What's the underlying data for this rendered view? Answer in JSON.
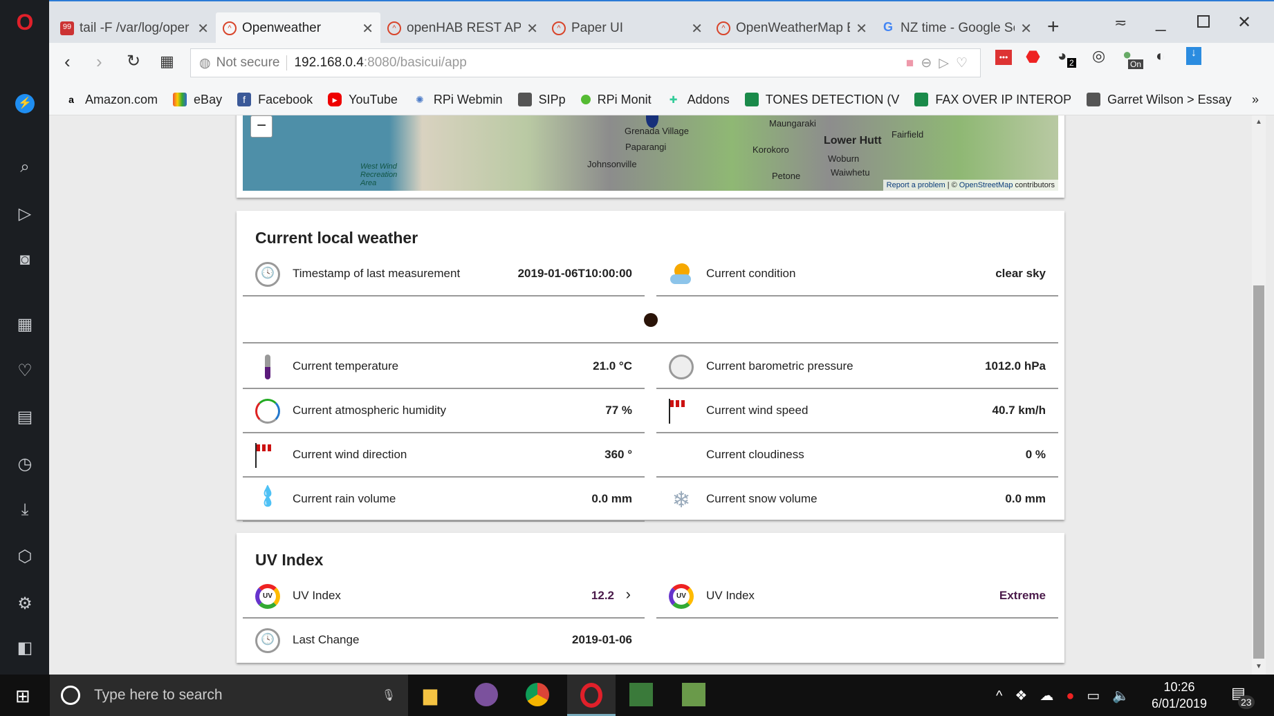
{
  "browser": {
    "tabs": [
      {
        "label": "tail -F /var/log/oper",
        "icon": "f99-icon"
      },
      {
        "label": "Openweather",
        "icon": "openhab-icon",
        "active": true
      },
      {
        "label": "openHAB REST API",
        "icon": "openhab-icon"
      },
      {
        "label": "Paper UI",
        "icon": "openhab-icon"
      },
      {
        "label": "OpenWeatherMap E",
        "icon": "openhab-icon"
      },
      {
        "label": "NZ time - Google Se",
        "icon": "google-icon"
      }
    ],
    "security": "Not secure",
    "url_host": "192.168.0.4",
    "url_rest": ":8080/basicui/app",
    "ext_badges": {
      "count": "2",
      "toggle": "On"
    },
    "bookmarks": [
      "Amazon.com",
      "eBay",
      "Facebook",
      "YouTube",
      "RPi Webmin",
      "SIPp",
      "RPi Monit",
      "Addons",
      "TONES DETECTION (V",
      "FAX OVER IP INTEROP",
      "Garret Wilson > Essay"
    ],
    "more": "»"
  },
  "map": {
    "zoom_out": "−",
    "places": [
      "Grenada Village",
      "Paparangi",
      "Johnsonville",
      "Maungaraki",
      "Lower Hutt",
      "Fairfield",
      "Korokoro",
      "Woburn",
      "Waiwhetu",
      "Petone",
      "West Wind Recreation Area"
    ],
    "report": "Report a problem",
    "attribution_prefix": "| ©",
    "osm": "OpenStreetMap",
    "attribution_suffix": "contributors"
  },
  "weather": {
    "title": "Current local weather",
    "timestamp": {
      "label": "Timestamp of last measurement",
      "value": "2019-01-06T10:00:00"
    },
    "condition": {
      "label": "Current condition",
      "value": "clear sky"
    },
    "rows": [
      {
        "label": "Current temperature",
        "value": "21.0 °C"
      },
      {
        "label": "Current barometric pressure",
        "value": "1012.0 hPa"
      },
      {
        "label": "Current atmospheric humidity",
        "value": "77 %"
      },
      {
        "label": "Current wind speed",
        "value": "40.7 km/h"
      },
      {
        "label": "Current wind direction",
        "value": "360 °"
      },
      {
        "label": "Current cloudiness",
        "value": "0 %"
      },
      {
        "label": "Current rain volume",
        "value": "0.0 mm"
      },
      {
        "label": "Current snow volume",
        "value": "0.0 mm"
      }
    ]
  },
  "uv": {
    "title": "UV Index",
    "index": {
      "label": "UV Index",
      "value": "12.2"
    },
    "level": {
      "label": "UV Index",
      "value": "Extreme"
    },
    "last_change": {
      "label": "Last Change",
      "value": "2019-01-06"
    },
    "value_color": "#4a1a4a"
  },
  "taskbar": {
    "search_placeholder": "Type here to search",
    "time": "10:26",
    "date": "6/01/2019",
    "notifications": "23"
  }
}
